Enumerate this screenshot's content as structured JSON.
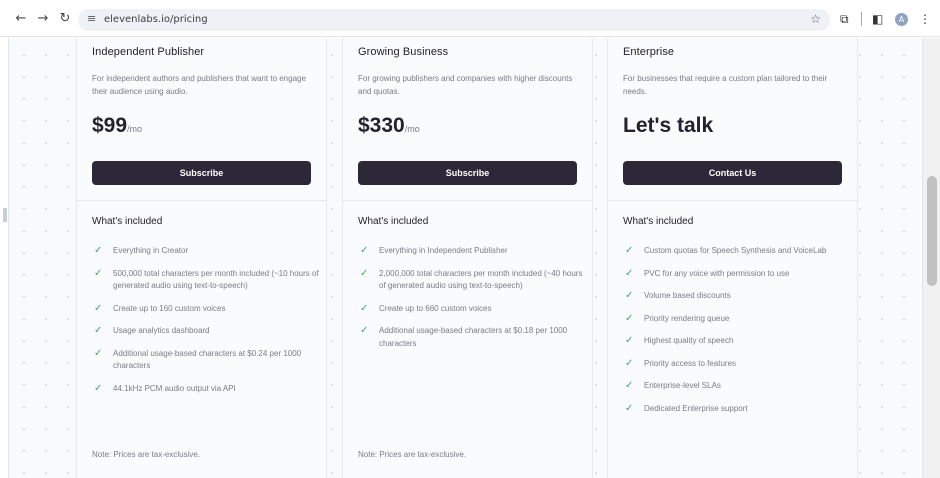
{
  "browser": {
    "url": "elevenlabs.io/pricing",
    "avatar_initial": "A",
    "icons": {
      "back": "arrow-left-icon",
      "forward": "arrow-right-icon",
      "reload": "reload-icon",
      "site_info": "tune-icon",
      "bookmark": "star-icon",
      "extensions": "puzzle-icon",
      "side_panel": "side-panel-icon",
      "menu": "kebab-menu-icon"
    }
  },
  "plans": [
    {
      "name": "Independent Publisher",
      "description": "For independent authors and publishers that want to engage their audience using audio.",
      "price": "$99",
      "price_unit": "/mo",
      "cta": "Subscribe",
      "included_heading": "What's included",
      "features": [
        "Everything in Creator",
        "500,000 total characters per month included (~10 hours of generated audio using text-to-speech)",
        "Create up to 160 custom voices",
        "Usage analytics dashboard",
        "Additional usage-based characters at $0.24 per 1000 characters",
        "44.1kHz PCM audio output via API"
      ],
      "note": "Note: Prices are tax-exclusive."
    },
    {
      "name": "Growing Business",
      "description": "For growing publishers and companies with higher discounts and quotas.",
      "price": "$330",
      "price_unit": "/mo",
      "cta": "Subscribe",
      "included_heading": "What's included",
      "features": [
        "Everything in Independent Publisher",
        "2,000,000 total characters per month included (~40 hours of generated audio using text-to-speech)",
        "Create up to 660 custom voices",
        "Additional usage-based characters at $0.18 per 1000 characters"
      ],
      "note": "Note: Prices are tax-exclusive."
    },
    {
      "name": "Enterprise",
      "description": "For businesses that require a custom plan tailored to their needs.",
      "price": "Let's talk",
      "price_unit": "",
      "cta": "Contact Us",
      "included_heading": "What's included",
      "features": [
        "Custom quotas for Speech Synthesis and VoiceLab",
        "PVC for any voice with permission to use",
        "Volume based discounts",
        "Priority rendering queue",
        "Highest quality of speech",
        "Priority access to features",
        "Enterprise-level SLAs",
        "Dedicated Enterprise support"
      ],
      "note": ""
    }
  ],
  "colors": {
    "button": "#2d2838",
    "check": "#3fa86a",
    "text": "#24202e",
    "muted": "#7c7a85",
    "accent_divider": "#e9a03c"
  }
}
